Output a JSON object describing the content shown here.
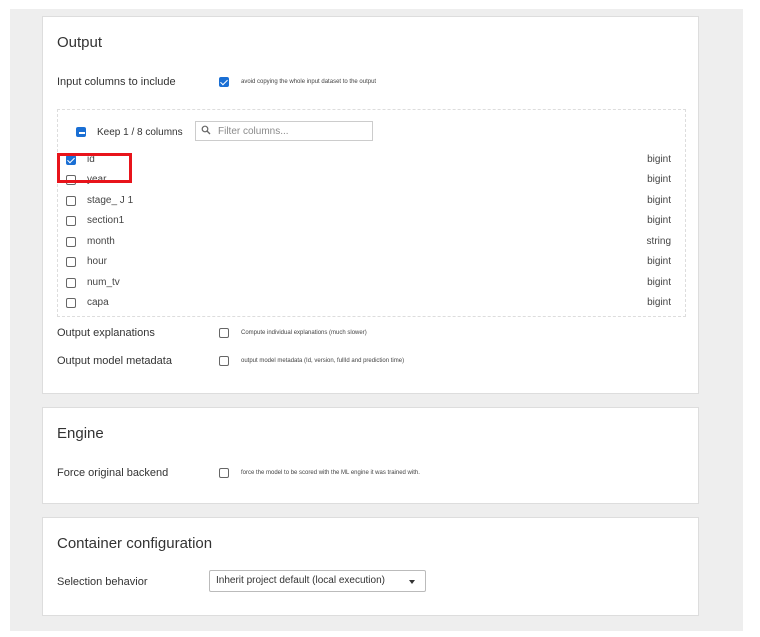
{
  "output": {
    "title": "Output",
    "input_columns_label": "Input columns to include",
    "avoid_copy": {
      "label": "avoid copying the whole input dataset to the output",
      "checked": true
    },
    "keep_label": "Keep 1 / 8 columns",
    "filter_placeholder": "Filter columns...",
    "columns": [
      {
        "name": "id",
        "type": "bigint",
        "checked": true
      },
      {
        "name": "year",
        "type": "bigint",
        "checked": false
      },
      {
        "name": "stage_ J 1",
        "type": "bigint",
        "checked": false
      },
      {
        "name": "section1",
        "type": "bigint",
        "checked": false
      },
      {
        "name": "month",
        "type": "string",
        "checked": false
      },
      {
        "name": "hour",
        "type": "bigint",
        "checked": false
      },
      {
        "name": "num_tv",
        "type": "bigint",
        "checked": false
      },
      {
        "name": "capa",
        "type": "bigint",
        "checked": false
      }
    ],
    "explanations": {
      "label": "Output explanations",
      "option": "Compute individual explanations (much slower)",
      "checked": false
    },
    "metadata": {
      "label": "Output model metadata",
      "option": "output model metadata (Id, version, fullId and prediction time)",
      "checked": false
    }
  },
  "engine": {
    "title": "Engine",
    "force_label": "Force original backend",
    "force_option": "force the model to be scored with the ML engine it was trained with.",
    "checked": false
  },
  "container": {
    "title": "Container configuration",
    "selection_label": "Selection behavior",
    "selection_value": "Inherit project default (local execution)"
  },
  "colors": {
    "accent": "#1a6fd4",
    "highlight": "#e8141b",
    "page_bg": "#eeeeee"
  },
  "icons": [
    "search-icon",
    "chevron-down-icon"
  ]
}
